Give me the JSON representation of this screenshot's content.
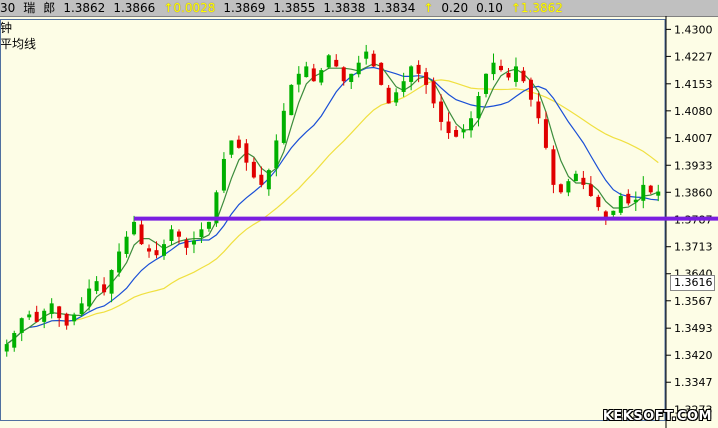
{
  "header": {
    "items": [
      "30",
      "瑞",
      "郎",
      "1.3862",
      "1.3866",
      "↑0.0028",
      "1.3869",
      "1.3855",
      "1.3838",
      "1.3834",
      "↑",
      "0.20",
      "0.10",
      "↑1.3862"
    ]
  },
  "indicators": {
    "line1": "钟",
    "line2": "平均线"
  },
  "watermark": "KEKSOFT.COM",
  "colors": {
    "background": "#fdfde6",
    "up_candle": "#00b000",
    "down_candle": "#e00000",
    "ma_short": "#3c8c3c",
    "ma_mid": "#1a4fd6",
    "ma_long": "#f0e040",
    "support_line": "#7a1ee0"
  },
  "chart_data": {
    "type": "candlestick",
    "y_ticks": [
      "1.4300",
      "1.4227",
      "1.4153",
      "1.4080",
      "1.4007",
      "1.3933",
      "1.3860",
      "1.3787",
      "1.3713",
      "1.3640",
      "1.3567",
      "1.3493",
      "1.3420",
      "1.3347",
      "1.3273"
    ],
    "ylim": [
      1.3245,
      1.4328
    ],
    "current_value": "1.3616",
    "support_line": {
      "level": 1.3789,
      "x_start_index": 17
    },
    "closes": [
      1.345,
      1.348,
      1.352,
      1.353,
      1.351,
      1.354,
      1.356,
      1.352,
      1.35,
      1.353,
      1.356,
      1.36,
      1.362,
      1.359,
      1.365,
      1.37,
      1.374,
      1.378,
      1.372,
      1.37,
      1.369,
      1.372,
      1.376,
      1.374,
      1.371,
      1.373,
      1.376,
      1.378,
      1.386,
      1.395,
      1.4,
      1.398,
      1.394,
      1.39,
      1.388,
      1.392,
      1.4,
      1.408,
      1.415,
      1.418,
      1.42,
      1.416,
      1.419,
      1.423,
      1.42,
      1.416,
      1.418,
      1.421,
      1.424,
      1.42,
      1.415,
      1.41,
      1.413,
      1.416,
      1.42,
      1.418,
      1.415,
      1.41,
      1.405,
      1.402,
      1.401,
      1.403,
      1.406,
      1.412,
      1.418,
      1.421,
      1.419,
      1.417,
      1.42,
      1.416,
      1.411,
      1.406,
      1.398,
      1.388,
      1.386,
      1.389,
      1.391,
      1.388,
      1.385,
      1.382,
      1.379,
      1.381,
      1.385,
      1.383,
      1.384,
      1.388,
      1.386,
      1.3862
    ]
  }
}
